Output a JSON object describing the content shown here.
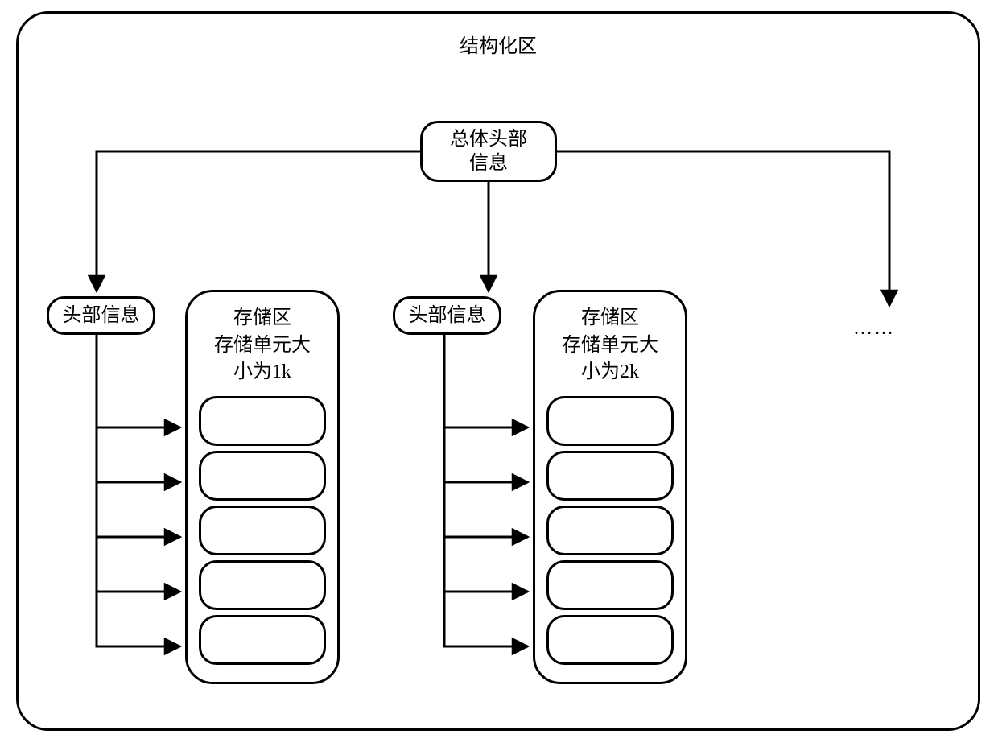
{
  "title": "结构化区",
  "master_header": "总体头部\n信息",
  "groups": [
    {
      "header_label": "头部信息",
      "storage_label": "存储区\n存储单元大\n小为1k",
      "unit_count": 5
    },
    {
      "header_label": "头部信息",
      "storage_label": "存储区\n存储单元大\n小为2k",
      "unit_count": 5
    }
  ],
  "ellipsis": "……"
}
